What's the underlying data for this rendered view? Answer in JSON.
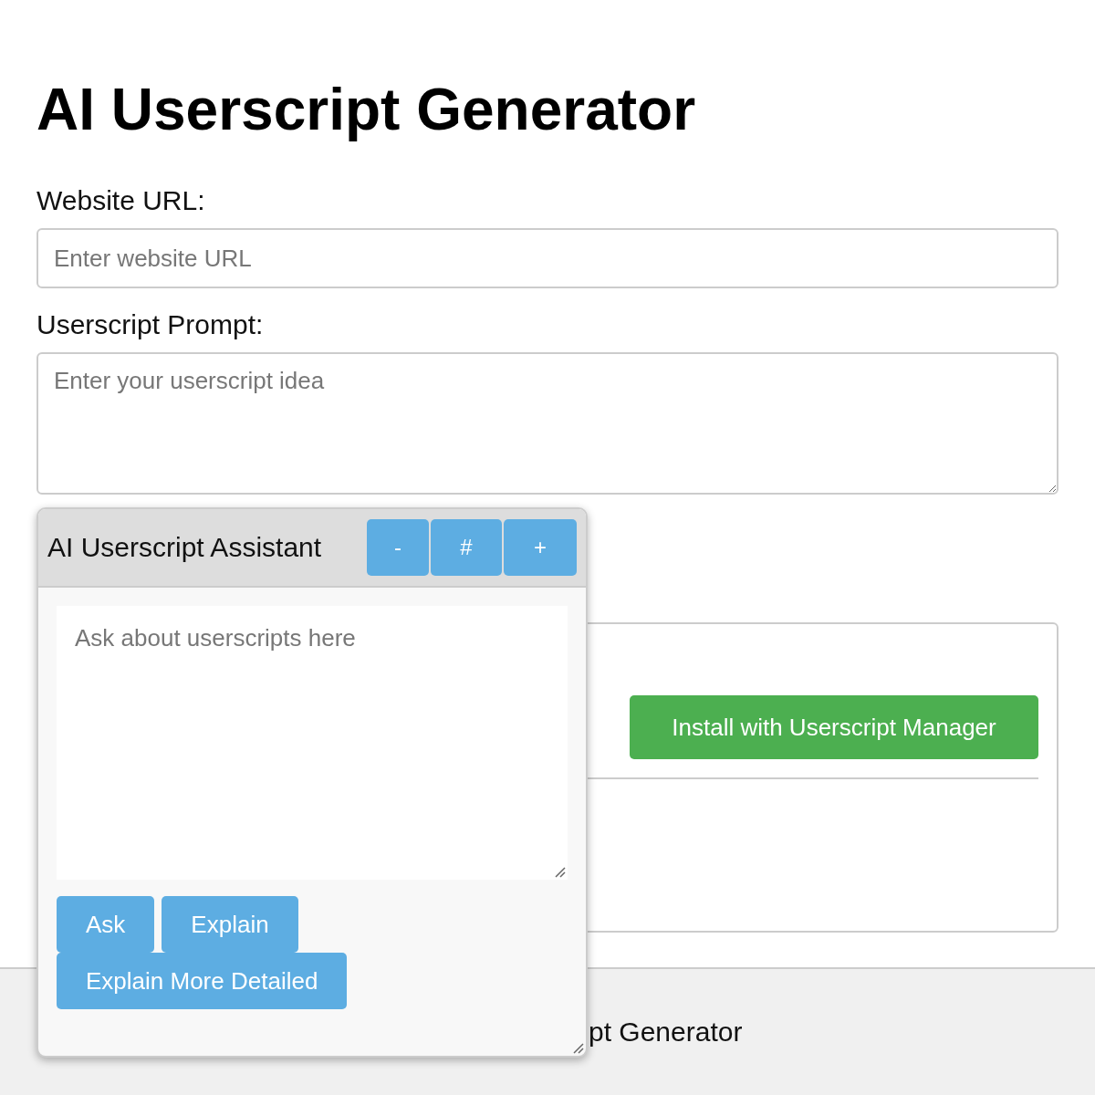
{
  "title": "AI Userscript Generator",
  "form": [
    {
      "kind": "input",
      "label": "Website URL:",
      "placeholder": "Enter website URL"
    },
    {
      "kind": "textarea",
      "label": "Userscript Prompt:",
      "placeholder": "Enter your userscript idea"
    }
  ],
  "result": {
    "install_button": "Install with Userscript Manager"
  },
  "footer": {
    "text": "pt Generator"
  },
  "assistant": {
    "title": "AI Userscript Assistant",
    "window_buttons": [
      "-",
      "#",
      "+"
    ],
    "placeholder": "Ask about userscripts here",
    "actions": [
      "Ask",
      "Explain",
      "Explain More Detailed"
    ]
  }
}
